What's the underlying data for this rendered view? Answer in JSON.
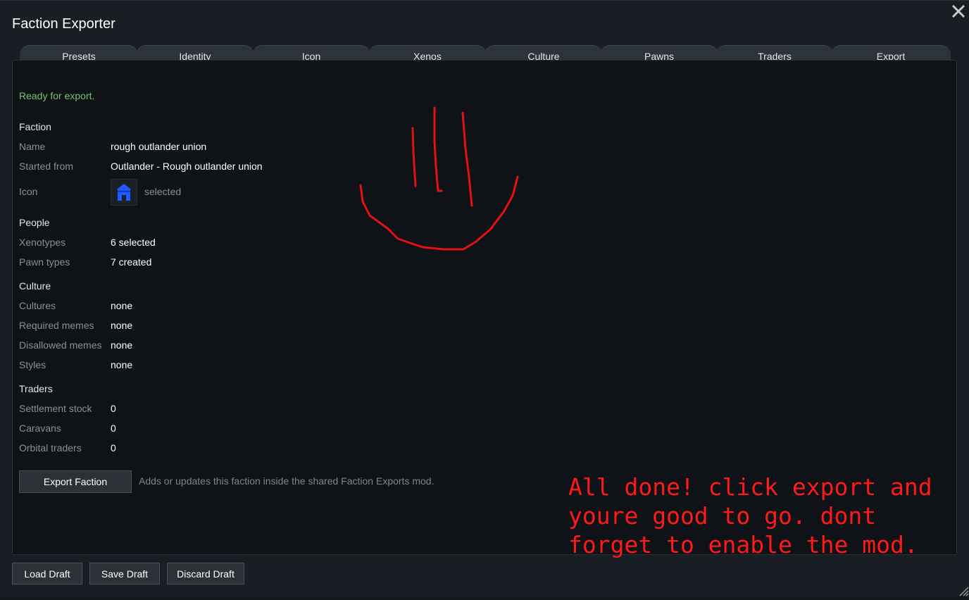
{
  "window": {
    "title": "Faction Exporter"
  },
  "tabs": [
    {
      "label": "Presets"
    },
    {
      "label": "Identity"
    },
    {
      "label": "Icon"
    },
    {
      "label": "Xenos"
    },
    {
      "label": "Culture"
    },
    {
      "label": "Pawns"
    },
    {
      "label": "Traders"
    },
    {
      "label": "Export"
    }
  ],
  "export": {
    "status": "Ready for export.",
    "status_color": "#74c46b",
    "faction": {
      "heading": "Faction",
      "name_label": "Name",
      "name_value": "rough outlander union",
      "started_label": "Started from",
      "started_value": "Outlander - Rough outlander union",
      "icon_label": "Icon",
      "icon_name": "house-icon",
      "icon_color": "#1a5cff",
      "icon_note": "selected"
    },
    "people": {
      "heading": "People",
      "xenotypes_label": "Xenotypes",
      "xenotypes_value": "6 selected",
      "pawn_types_label": "Pawn types",
      "pawn_types_value": "7 created"
    },
    "culture": {
      "heading": "Culture",
      "cultures_label": "Cultures",
      "cultures_value": "none",
      "required_label": "Required memes",
      "required_value": "none",
      "disallowed_label": "Disallowed memes",
      "disallowed_value": "none",
      "styles_label": "Styles",
      "styles_value": "none"
    },
    "traders": {
      "heading": "Traders",
      "settlement_label": "Settlement stock",
      "settlement_value": "0",
      "caravans_label": "Caravans",
      "caravans_value": "0",
      "orbital_label": "Orbital traders",
      "orbital_value": "0"
    },
    "export_button": "Export Faction",
    "export_hint": "Adds or updates this faction inside the shared Faction Exports mod."
  },
  "footer": {
    "load_draft": "Load Draft",
    "save_draft": "Save Draft",
    "discard_draft": "Discard Draft"
  },
  "annotation": {
    "text": "All done! click export and\nyoure good to go. dont\nforget to enable the mod.",
    "color": "#ff1a1a"
  }
}
